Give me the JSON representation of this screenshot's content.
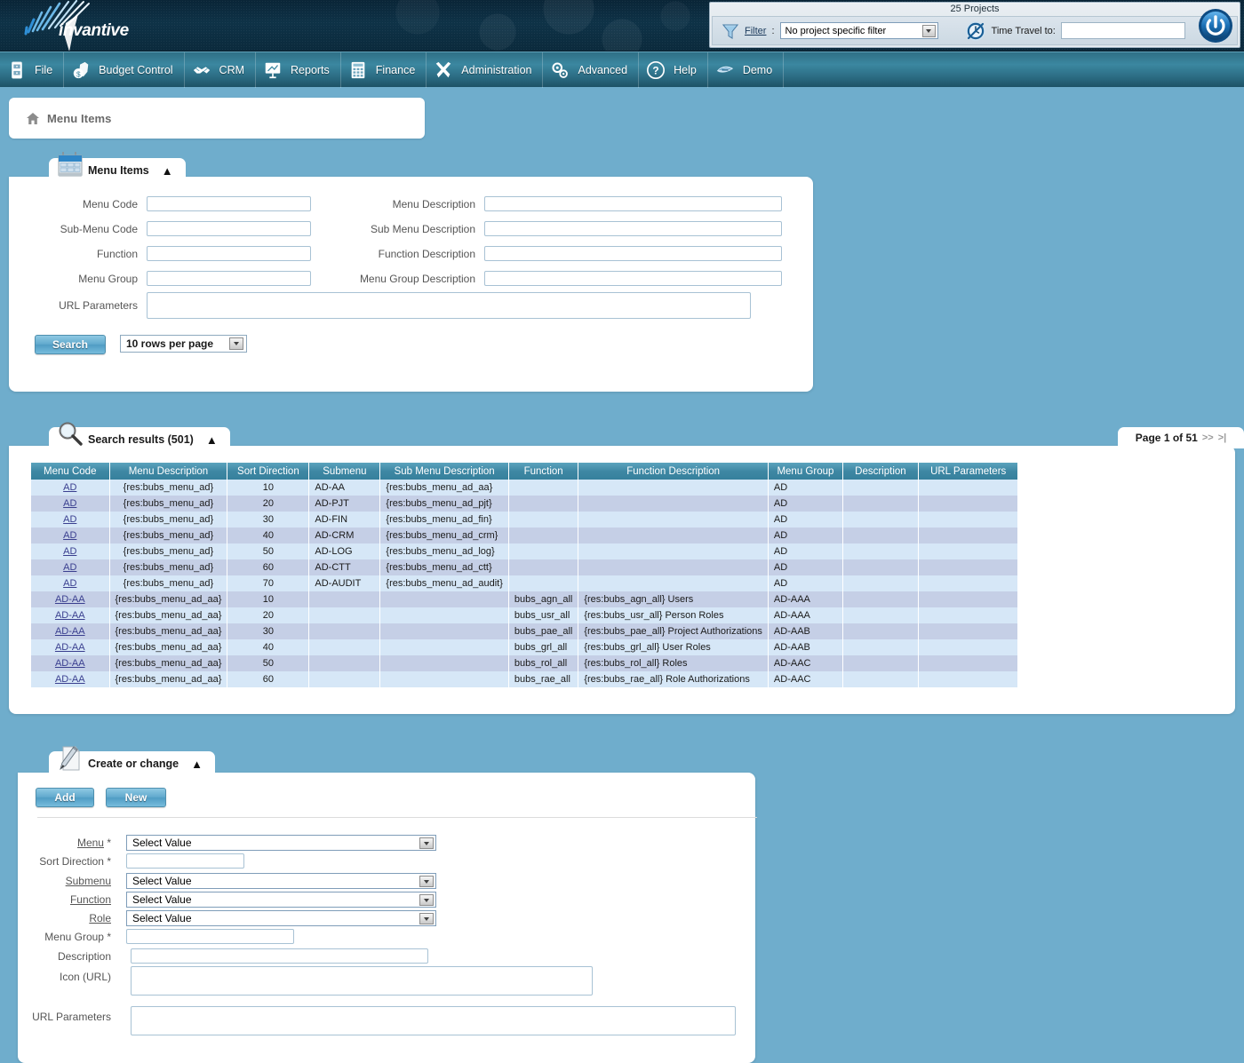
{
  "banner": {
    "logo_text": "invantive",
    "logo_icon": "starburst-logo-icon"
  },
  "topbar": {
    "projects_count": "25 Projects",
    "filter_icon": "funnel-icon",
    "filter_label": "Filter",
    "filter_colon": ":",
    "filter_value": "No project specific filter",
    "clock_icon": "time-travel-clock-icon",
    "time_travel_label": "Time Travel to:",
    "time_travel_value": "",
    "power_icon": "power-button-icon"
  },
  "menubar": {
    "items": [
      {
        "label": "File",
        "icon": "file-cabinet-icon"
      },
      {
        "label": "Budget Control",
        "icon": "money-bag-shield-icon"
      },
      {
        "label": "CRM",
        "icon": "handshake-icon"
      },
      {
        "label": "Reports",
        "icon": "presentation-chart-icon"
      },
      {
        "label": "Finance",
        "icon": "calculator-icon"
      },
      {
        "label": "Administration",
        "icon": "tools-wrench-screwdriver-icon"
      },
      {
        "label": "Advanced",
        "icon": "gears-icon"
      },
      {
        "label": "Help",
        "icon": "question-mark-circle-icon"
      },
      {
        "label": "Demo",
        "icon": "invantive-bird-icon"
      }
    ]
  },
  "breadcrumb": {
    "home_icon": "home-icon",
    "text": "Menu Items"
  },
  "search_panel": {
    "tab_label": "Menu Items",
    "tab_icon": "table-grid-icon",
    "collapse_icon": "chevron-up-icon",
    "fields_left": [
      {
        "label": "Menu Code",
        "value": ""
      },
      {
        "label": "Sub-Menu Code",
        "value": ""
      },
      {
        "label": "Function",
        "value": ""
      },
      {
        "label": "Menu Group",
        "value": ""
      }
    ],
    "fields_right": [
      {
        "label": "Menu Description",
        "value": ""
      },
      {
        "label": "Sub Menu Description",
        "value": ""
      },
      {
        "label": "Function Description",
        "value": ""
      },
      {
        "label": "Menu Group Description",
        "value": ""
      }
    ],
    "url_parameters": {
      "label": "URL Parameters",
      "value": ""
    },
    "search_button": "Search",
    "rows_per_page": "10 rows per page"
  },
  "results_panel": {
    "tab_label": "Search results (501)",
    "tab_icon": "magnifier-icon",
    "collapse_icon": "chevron-up-icon",
    "pager": {
      "text": "Page 1 of 51",
      "next": ">>",
      "last": ">|"
    },
    "columns": [
      "Menu Code",
      "Menu Description",
      "Sort Direction",
      "Submenu",
      "Sub Menu Description",
      "Function",
      "Function Description",
      "Menu Group",
      "Description",
      "URL Parameters"
    ],
    "rows": [
      {
        "menu_code": "AD",
        "menu_description": "{res:bubs_menu_ad}",
        "sort_direction": "10",
        "submenu": "AD-AA",
        "sub_menu_description": "{res:bubs_menu_ad_aa}",
        "function": "",
        "function_description": "",
        "menu_group": "AD",
        "description": "",
        "url_parameters": ""
      },
      {
        "menu_code": "AD",
        "menu_description": "{res:bubs_menu_ad}",
        "sort_direction": "20",
        "submenu": "AD-PJT",
        "sub_menu_description": "{res:bubs_menu_ad_pjt}",
        "function": "",
        "function_description": "",
        "menu_group": "AD",
        "description": "",
        "url_parameters": ""
      },
      {
        "menu_code": "AD",
        "menu_description": "{res:bubs_menu_ad}",
        "sort_direction": "30",
        "submenu": "AD-FIN",
        "sub_menu_description": "{res:bubs_menu_ad_fin}",
        "function": "",
        "function_description": "",
        "menu_group": "AD",
        "description": "",
        "url_parameters": ""
      },
      {
        "menu_code": "AD",
        "menu_description": "{res:bubs_menu_ad}",
        "sort_direction": "40",
        "submenu": "AD-CRM",
        "sub_menu_description": "{res:bubs_menu_ad_crm}",
        "function": "",
        "function_description": "",
        "menu_group": "AD",
        "description": "",
        "url_parameters": ""
      },
      {
        "menu_code": "AD",
        "menu_description": "{res:bubs_menu_ad}",
        "sort_direction": "50",
        "submenu": "AD-LOG",
        "sub_menu_description": "{res:bubs_menu_ad_log}",
        "function": "",
        "function_description": "",
        "menu_group": "AD",
        "description": "",
        "url_parameters": ""
      },
      {
        "menu_code": "AD",
        "menu_description": "{res:bubs_menu_ad}",
        "sort_direction": "60",
        "submenu": "AD-CTT",
        "sub_menu_description": "{res:bubs_menu_ad_ctt}",
        "function": "",
        "function_description": "",
        "menu_group": "AD",
        "description": "",
        "url_parameters": ""
      },
      {
        "menu_code": "AD",
        "menu_description": "{res:bubs_menu_ad}",
        "sort_direction": "70",
        "submenu": "AD-AUDIT",
        "sub_menu_description": "{res:bubs_menu_ad_audit}",
        "function": "",
        "function_description": "",
        "menu_group": "AD",
        "description": "",
        "url_parameters": ""
      },
      {
        "menu_code": "AD-AA",
        "menu_description": "{res:bubs_menu_ad_aa}",
        "sort_direction": "10",
        "submenu": "",
        "sub_menu_description": "",
        "function": "bubs_agn_all",
        "function_description": "{res:bubs_agn_all} Users",
        "menu_group": "AD-AAA",
        "description": "",
        "url_parameters": ""
      },
      {
        "menu_code": "AD-AA",
        "menu_description": "{res:bubs_menu_ad_aa}",
        "sort_direction": "20",
        "submenu": "",
        "sub_menu_description": "",
        "function": "bubs_usr_all",
        "function_description": "{res:bubs_usr_all} Person Roles",
        "menu_group": "AD-AAA",
        "description": "",
        "url_parameters": ""
      },
      {
        "menu_code": "AD-AA",
        "menu_description": "{res:bubs_menu_ad_aa}",
        "sort_direction": "30",
        "submenu": "",
        "sub_menu_description": "",
        "function": "bubs_pae_all",
        "function_description": "{res:bubs_pae_all} Project Authorizations",
        "menu_group": "AD-AAB",
        "description": "",
        "url_parameters": ""
      },
      {
        "menu_code": "AD-AA",
        "menu_description": "{res:bubs_menu_ad_aa}",
        "sort_direction": "40",
        "submenu": "",
        "sub_menu_description": "",
        "function": "bubs_grl_all",
        "function_description": "{res:bubs_grl_all} User Roles",
        "menu_group": "AD-AAB",
        "description": "",
        "url_parameters": ""
      },
      {
        "menu_code": "AD-AA",
        "menu_description": "{res:bubs_menu_ad_aa}",
        "sort_direction": "50",
        "submenu": "",
        "sub_menu_description": "",
        "function": "bubs_rol_all",
        "function_description": "{res:bubs_rol_all} Roles",
        "menu_group": "AD-AAC",
        "description": "",
        "url_parameters": ""
      },
      {
        "menu_code": "AD-AA",
        "menu_description": "{res:bubs_menu_ad_aa}",
        "sort_direction": "60",
        "submenu": "",
        "sub_menu_description": "",
        "function": "bubs_rae_all",
        "function_description": "{res:bubs_rae_all} Role Authorizations",
        "menu_group": "AD-AAC",
        "description": "",
        "url_parameters": ""
      }
    ]
  },
  "create_panel": {
    "tab_label": "Create or change",
    "tab_icon": "pencil-document-icon",
    "collapse_icon": "chevron-up-icon",
    "add_button": "Add",
    "new_button": "New",
    "fields": {
      "menu": {
        "label": "Menu",
        "required": "*",
        "value": "Select Value"
      },
      "sort_direction": {
        "label": "Sort Direction",
        "required": "*",
        "value": ""
      },
      "submenu": {
        "label": "Submenu",
        "value": "Select Value"
      },
      "function": {
        "label": "Function",
        "value": "Select Value"
      },
      "role": {
        "label": "Role",
        "value": "Select Value"
      },
      "menu_group": {
        "label": "Menu Group",
        "required": "*",
        "value": ""
      },
      "description": {
        "label": "Description",
        "value": ""
      },
      "icon_url": {
        "label": "Icon (URL)",
        "value": ""
      },
      "url_parameters": {
        "label": "URL Parameters",
        "value": ""
      }
    }
  },
  "colors": {
    "page_background": "#6fadcc",
    "banner": "#0e3247",
    "menubar": "#3b87a0",
    "table_header": "#3f88a4",
    "row_odd": "#d6e7f7",
    "row_even": "#c5cfe6",
    "link": "#3a3f8f"
  }
}
